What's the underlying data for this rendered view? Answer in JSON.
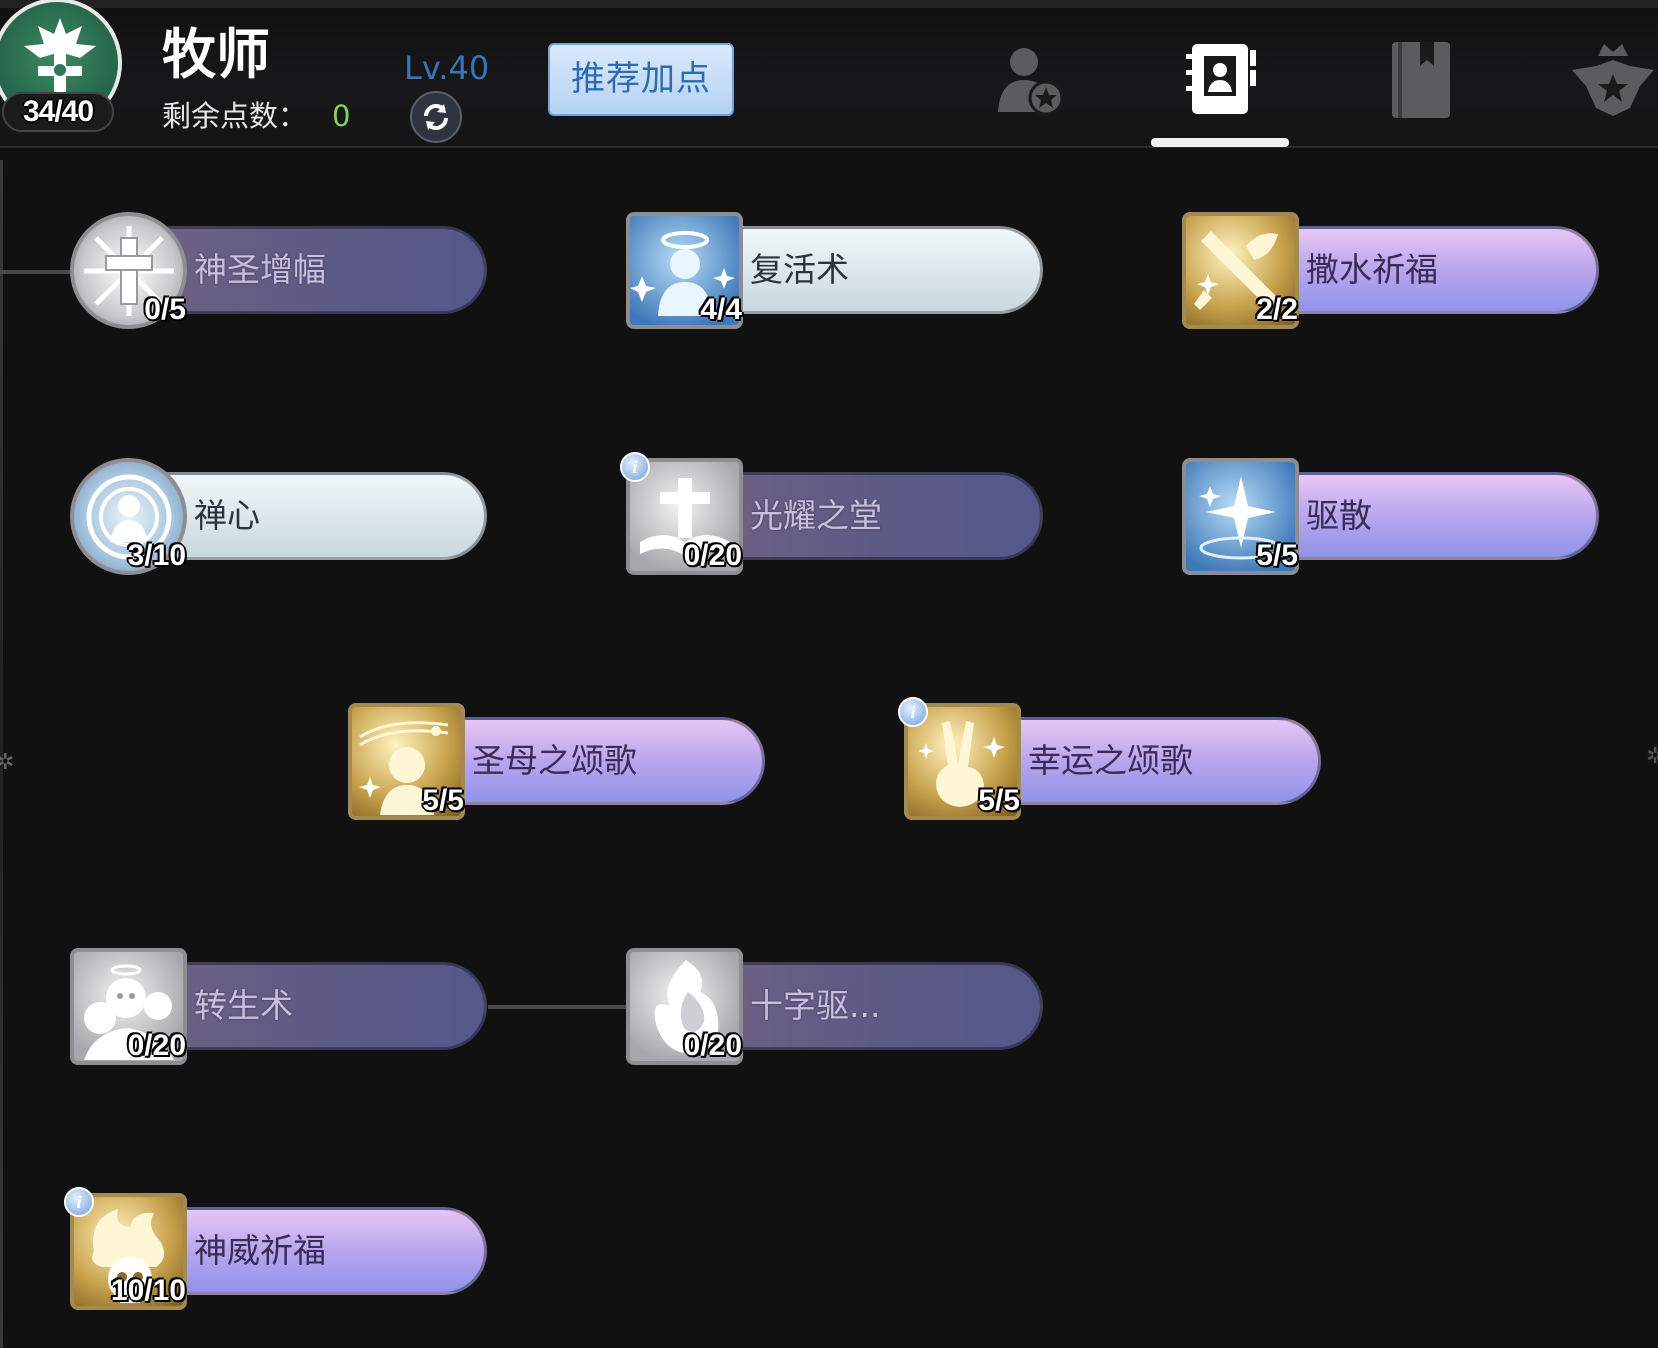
{
  "header": {
    "class_name": "牧师",
    "class_level_badge": "34/40",
    "points_label": "剩余点数：",
    "points_value": "0",
    "level": "Lv.40",
    "recommend_label": "推荐加点",
    "tabs": [
      "character-icon",
      "skill-book-icon",
      "journal-icon",
      "emblem-icon"
    ],
    "active_tab_index": 1
  },
  "skills": [
    {
      "name": "神圣增幅",
      "level": "0/5"
    },
    {
      "name": "复活术",
      "level": "4/4"
    },
    {
      "name": "撒水祈福",
      "level": "2/2"
    },
    {
      "name": "禅心",
      "level": "3/10"
    },
    {
      "name": "光耀之堂",
      "level": "0/20"
    },
    {
      "name": "驱散",
      "level": "5/5"
    },
    {
      "name": "圣母之颂歌",
      "level": "5/5"
    },
    {
      "name": "幸运之颂歌",
      "level": "5/5"
    },
    {
      "name": "转生术",
      "level": "0/20"
    },
    {
      "name": "十字驱...",
      "level": "0/20"
    },
    {
      "name": "神威祈福",
      "level": "10/10"
    }
  ],
  "colors": {
    "background": "#111112",
    "points_value": "#7fd45a",
    "level_text": "#3b74b9",
    "recommend_text": "#2d6bb2",
    "bar_unlearned": "#5d5a86",
    "bar_partial": "#e6eff3",
    "bar_maxed": "#b9a5ee"
  }
}
